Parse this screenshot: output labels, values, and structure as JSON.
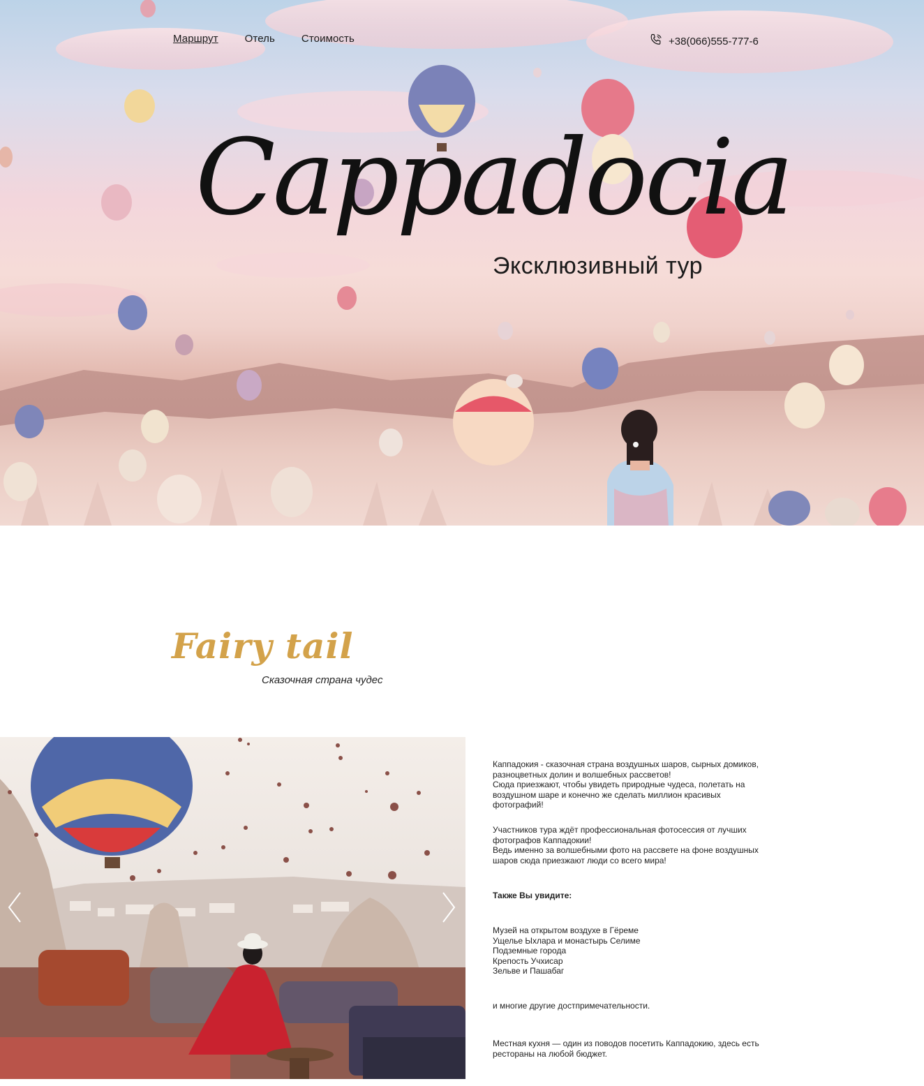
{
  "header": {
    "nav": [
      {
        "label": "Маршрут",
        "active": true
      },
      {
        "label": "Отель",
        "active": false
      },
      {
        "label": "Стоимость",
        "active": false
      }
    ],
    "phone": "+38(066)555-777-6",
    "phone_icon": "phone-icon"
  },
  "hero": {
    "title": "Cappadocia",
    "subtitle": "Эксклюзивный тур"
  },
  "fairy": {
    "title": "Fairy tail",
    "subtitle": "Сказочная страна чудес",
    "gallery": {
      "prev_icon": "chevron-left-icon",
      "next_icon": "chevron-right-icon"
    },
    "paragraphs": {
      "p1": "Каппадокия - сказочная страна воздушных шаров, сырных домиков,\nразноцветных долин и волшебных рассветов!\nСюда приезжают, чтобы увидеть природные чудеса, полетать на\nвоздушном шаре и конечно же сделать миллион красивых фотографий!",
      "p2": "Участников тура ждёт профессиональная фотосессия от лучших\nфотографов Каппадокии!\nВедь именно за волшебными фото на рассвете на фоне воздушных\nшаров сюда приезжают люди со всего мира!",
      "p3": "Также Вы увидите:",
      "p4": "Музей на открытом воздухе в Гёреме\nУщелье Ыхлара и монастырь Селиме\nПодземные города\nКрепость Учхисар\nЗельве и Пашабаг",
      "p5": "и многие другие достпримечательности.",
      "p6": "Местная кухня — один из поводов посетить Каппадокию, здесь есть\nрестораны на любой бюджет."
    }
  },
  "colors": {
    "accent_gold": "#d3a24a",
    "text_dark": "#1a1a1a"
  }
}
